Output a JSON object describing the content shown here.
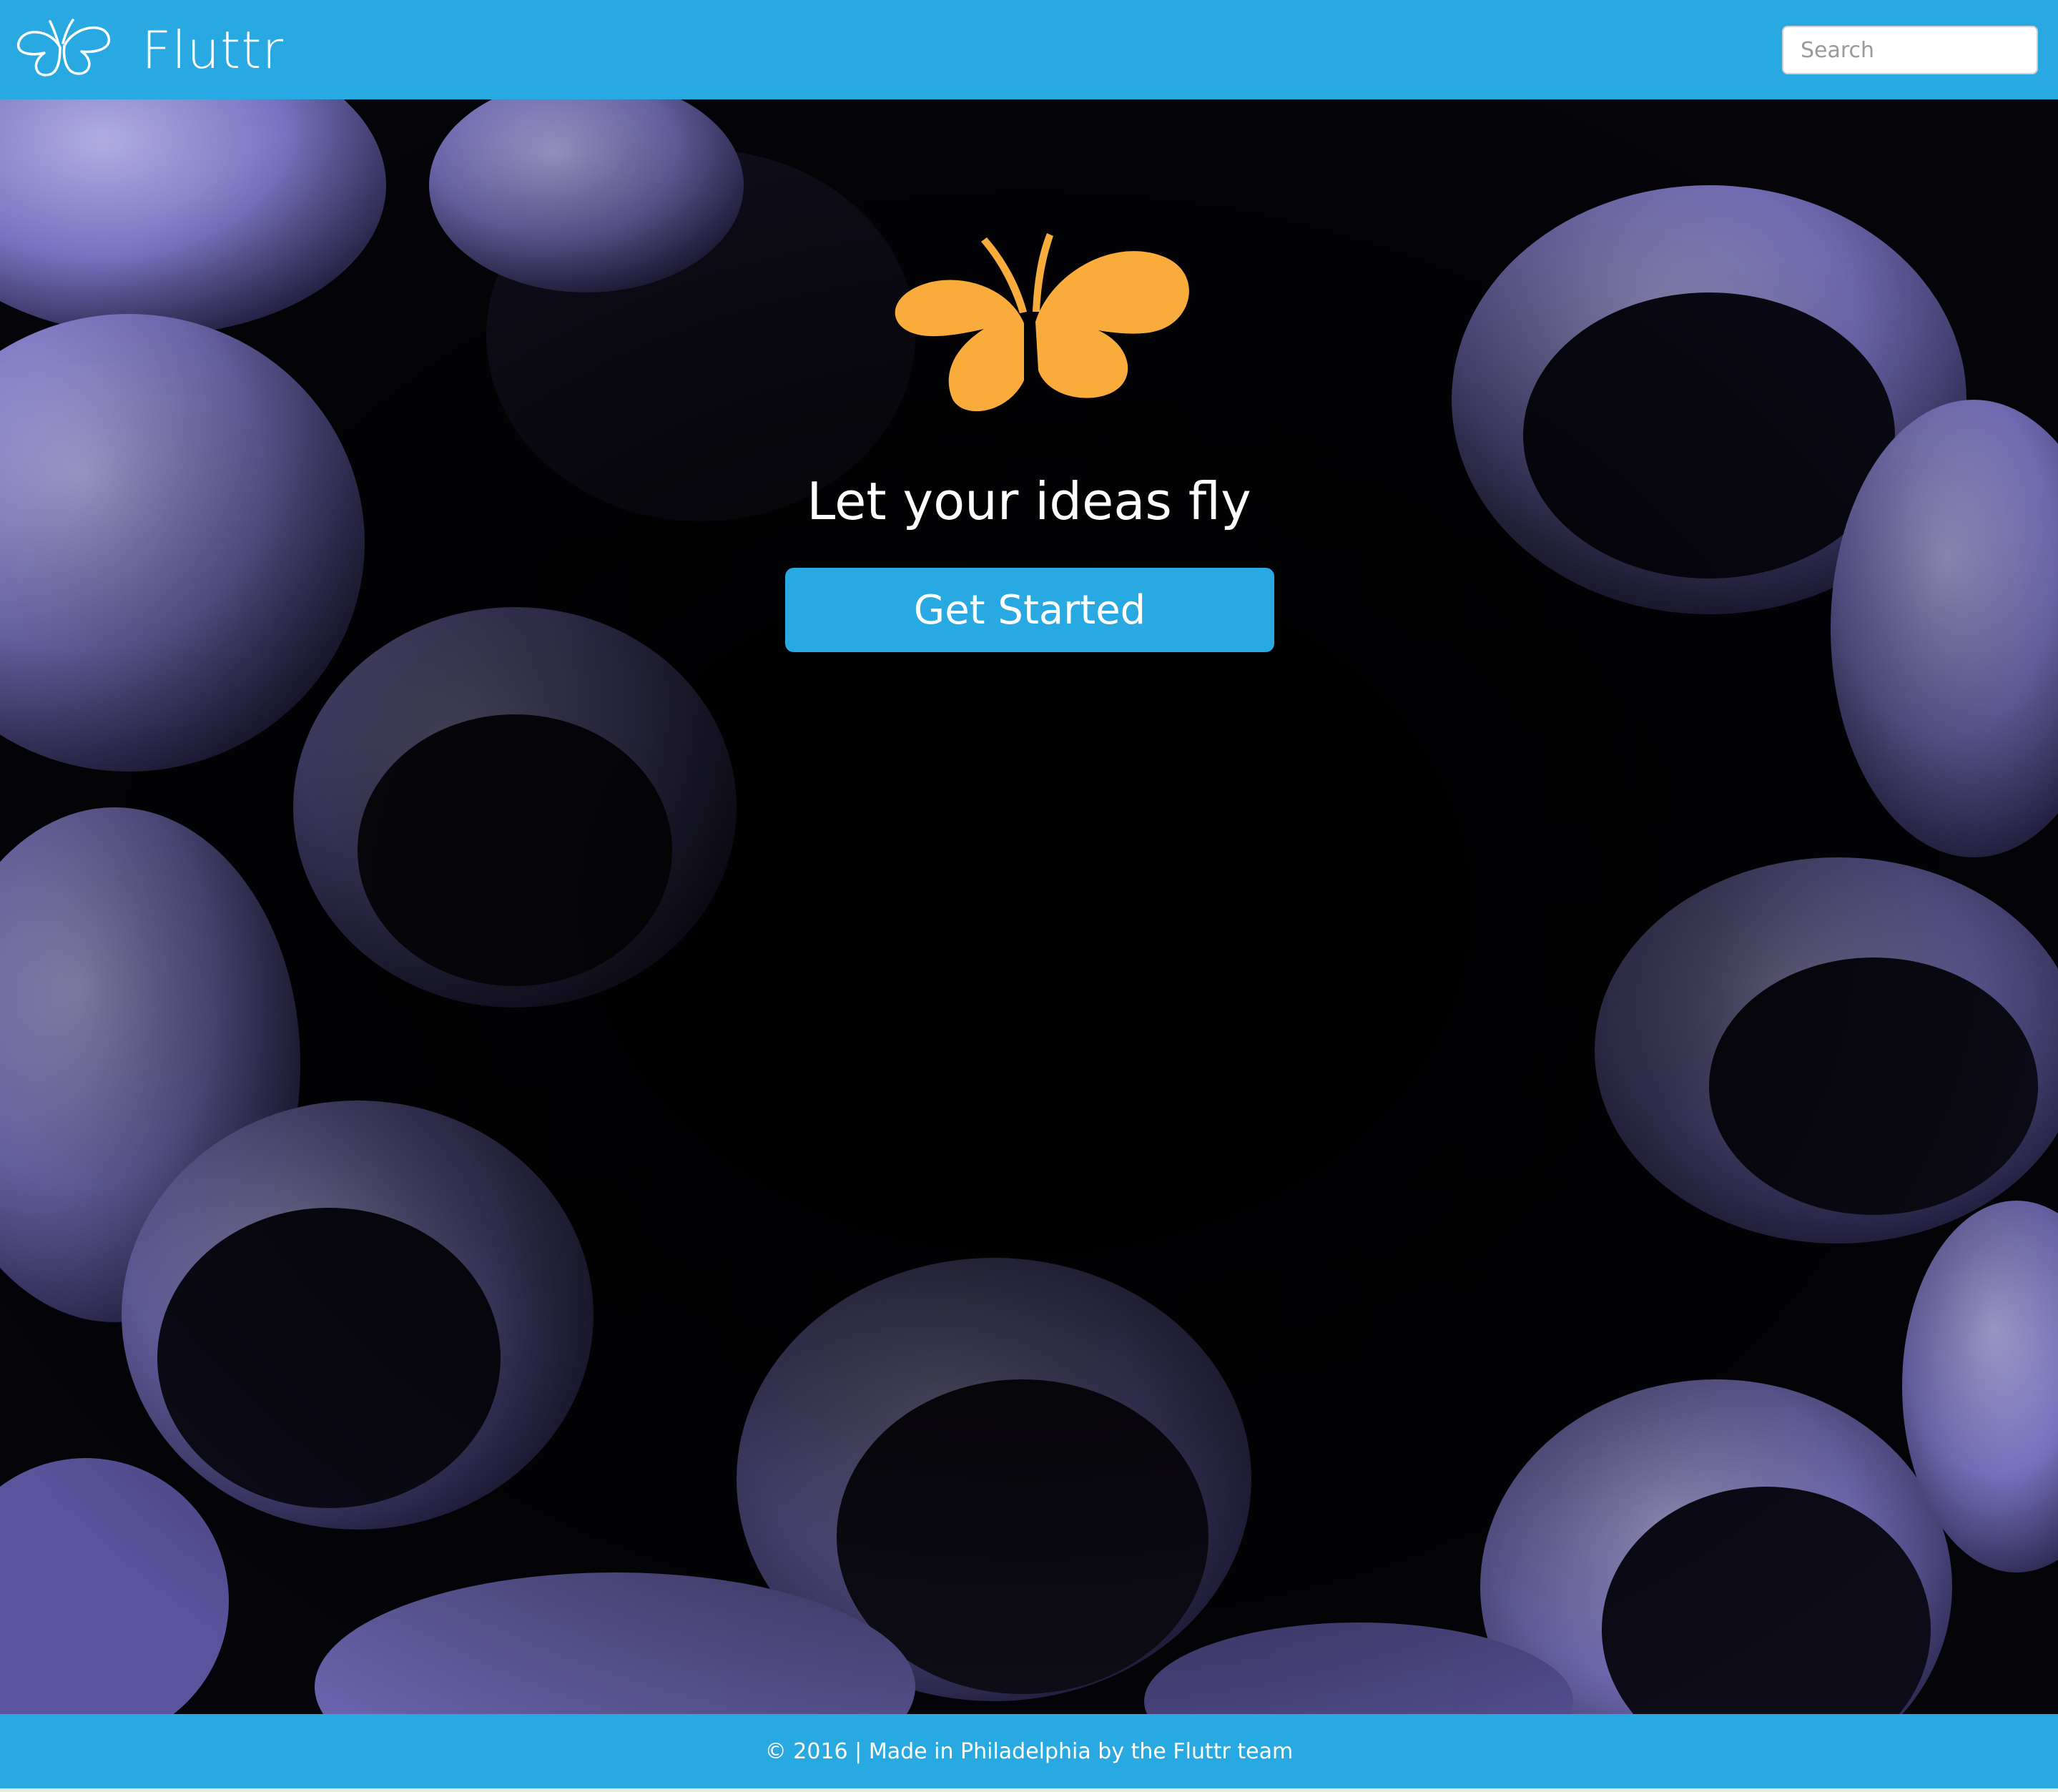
{
  "navbar": {
    "brand_name": "Fluttr",
    "logo_icon": "butterfly-outline-icon",
    "search": {
      "placeholder": "Search",
      "value": ""
    }
  },
  "hero": {
    "logo_icon": "butterfly-icon",
    "tagline": "Let your ideas fly",
    "cta_label": "Get Started",
    "background": "football-players-huddle-photo"
  },
  "footer": {
    "text": "© 2016 | Made in Philadelphia by the Fluttr team"
  },
  "colors": {
    "brand_blue": "#29a9e1",
    "logo_orange": "#f9ab3c",
    "hero_tint": "#7b76c6"
  }
}
